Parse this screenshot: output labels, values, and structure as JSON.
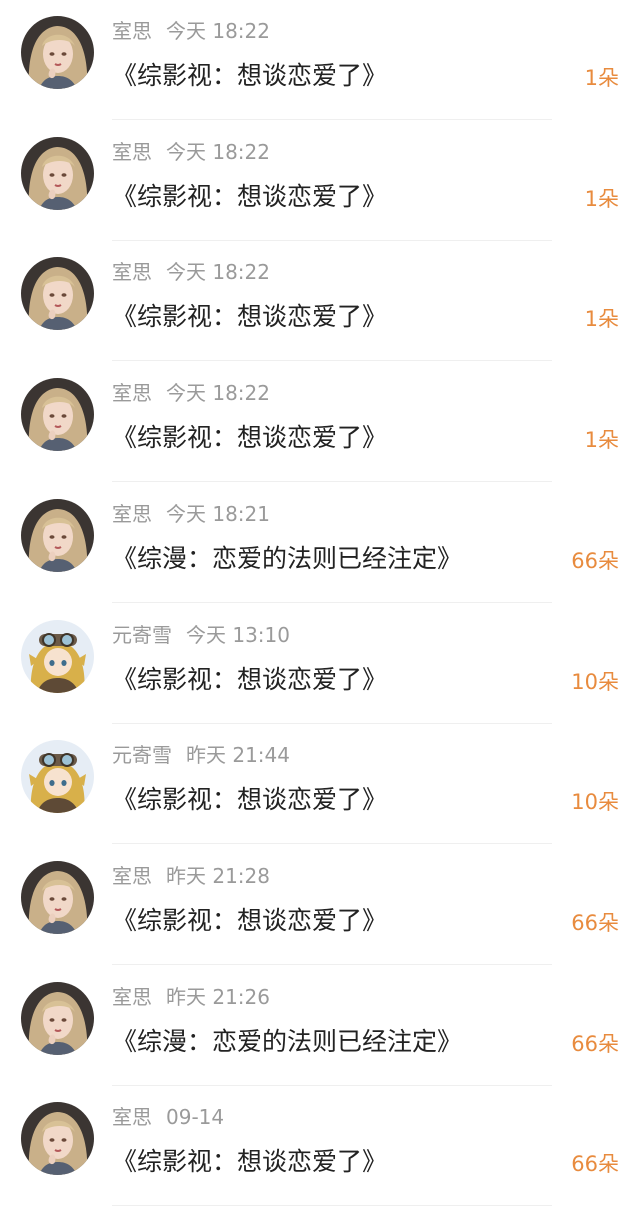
{
  "colors": {
    "name_text": "#9a9a9a",
    "title_text": "#222222",
    "amount_accent": "#e88b3e",
    "divider": "#efefef"
  },
  "gifts": [
    {
      "user": "室思",
      "time": "今天 18:22",
      "work": "《综影视：想谈恋爱了》",
      "amount": "1朵",
      "avatar": "avatar-blonde-girl-icon"
    },
    {
      "user": "室思",
      "time": "今天 18:22",
      "work": "《综影视：想谈恋爱了》",
      "amount": "1朵",
      "avatar": "avatar-blonde-girl-icon"
    },
    {
      "user": "室思",
      "time": "今天 18:22",
      "work": "《综影视：想谈恋爱了》",
      "amount": "1朵",
      "avatar": "avatar-blonde-girl-icon"
    },
    {
      "user": "室思",
      "time": "今天 18:22",
      "work": "《综影视：想谈恋爱了》",
      "amount": "1朵",
      "avatar": "avatar-blonde-girl-icon"
    },
    {
      "user": "室思",
      "time": "今天 18:21",
      "work": "《综漫：恋爱的法则已经注定》",
      "amount": "66朵",
      "avatar": "avatar-blonde-girl-icon"
    },
    {
      "user": "元寄雪",
      "time": "今天 13:10",
      "work": "《综影视：想谈恋爱了》",
      "amount": "10朵",
      "avatar": "avatar-goggles-chibi-icon"
    },
    {
      "user": "元寄雪",
      "time": "昨天 21:44",
      "work": "《综影视：想谈恋爱了》",
      "amount": "10朵",
      "avatar": "avatar-goggles-chibi-icon"
    },
    {
      "user": "室思",
      "time": "昨天 21:28",
      "work": "《综影视：想谈恋爱了》",
      "amount": "66朵",
      "avatar": "avatar-blonde-girl-icon"
    },
    {
      "user": "室思",
      "time": "昨天 21:26",
      "work": "《综漫：恋爱的法则已经注定》",
      "amount": "66朵",
      "avatar": "avatar-blonde-girl-icon"
    },
    {
      "user": "室思",
      "time": "09-14",
      "work": "《综影视：想谈恋爱了》",
      "amount": "66朵",
      "avatar": "avatar-blonde-girl-icon"
    }
  ]
}
